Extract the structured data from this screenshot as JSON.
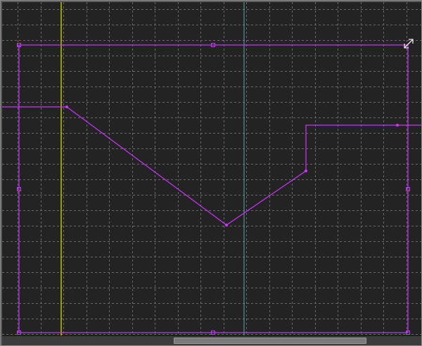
{
  "editor": {
    "grid_color": "#6a6a6a",
    "background_color": "#232323",
    "selection_color": "#cc33ff",
    "playhead_color": "#e6e600",
    "cursor_line_color": "#5fa3a3",
    "resize_icon": "resize-diagonal-icon"
  },
  "scrollbar": {
    "position_fraction": 0.41,
    "visible_fraction": 0.46
  }
}
